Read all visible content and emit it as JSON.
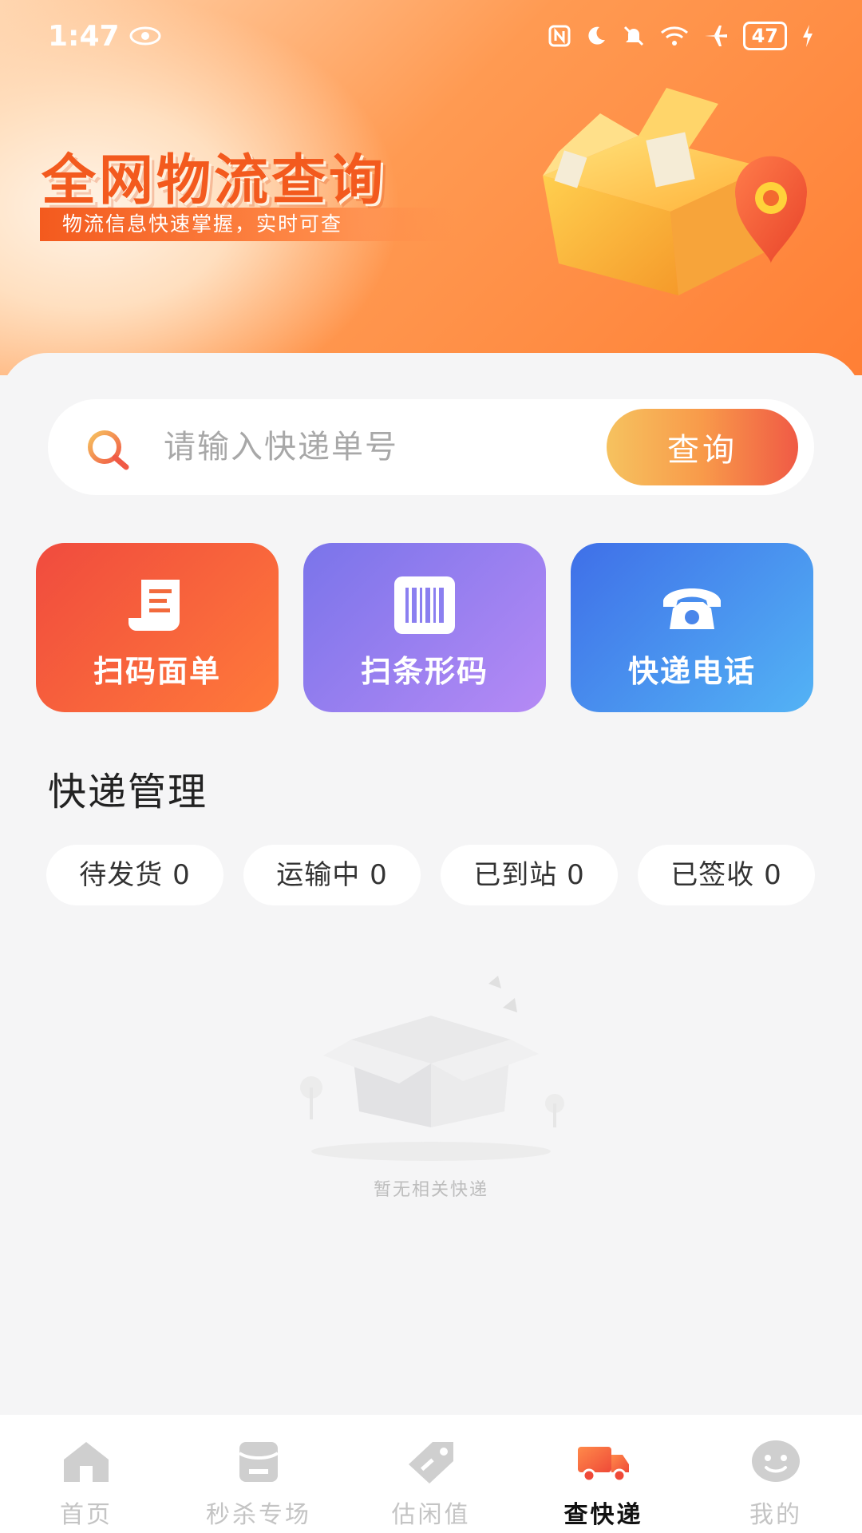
{
  "status_bar": {
    "time": "1:47",
    "battery": "47",
    "icons": [
      "eye-icon",
      "nfc-icon",
      "moon-icon",
      "mute-icon",
      "wifi-icon",
      "airplane-icon",
      "battery-icon",
      "charging-icon"
    ]
  },
  "banner": {
    "title": "全网物流查询",
    "subtitle": "物流信息快速掌握，实时可查"
  },
  "search": {
    "placeholder": "请输入快递单号",
    "button_label": "查询"
  },
  "actions": [
    {
      "label": "扫码面单",
      "icon": "receipt-icon",
      "color": "#f04b3e"
    },
    {
      "label": "扫条形码",
      "icon": "barcode-icon",
      "color": "#7a74ea"
    },
    {
      "label": "快递电话",
      "icon": "phone-icon",
      "color": "#3f6fe8"
    }
  ],
  "management": {
    "title": "快递管理",
    "chips": [
      "待发货 0",
      "运输中 0",
      "已到站 0",
      "已签收 0"
    ]
  },
  "empty_state": {
    "text": "暂无相关快递"
  },
  "tabbar": {
    "items": [
      {
        "label": "首页",
        "icon": "home-icon",
        "active": false
      },
      {
        "label": "秒杀专场",
        "icon": "flash-sale-icon",
        "active": false
      },
      {
        "label": "估闲值",
        "icon": "price-tag-icon",
        "active": false
      },
      {
        "label": "查快递",
        "icon": "delivery-truck-icon",
        "active": true
      },
      {
        "label": "我的",
        "icon": "profile-face-icon",
        "active": false
      }
    ]
  },
  "colors": {
    "accent": "#ff7f35",
    "active_tab": "#f5613a"
  }
}
